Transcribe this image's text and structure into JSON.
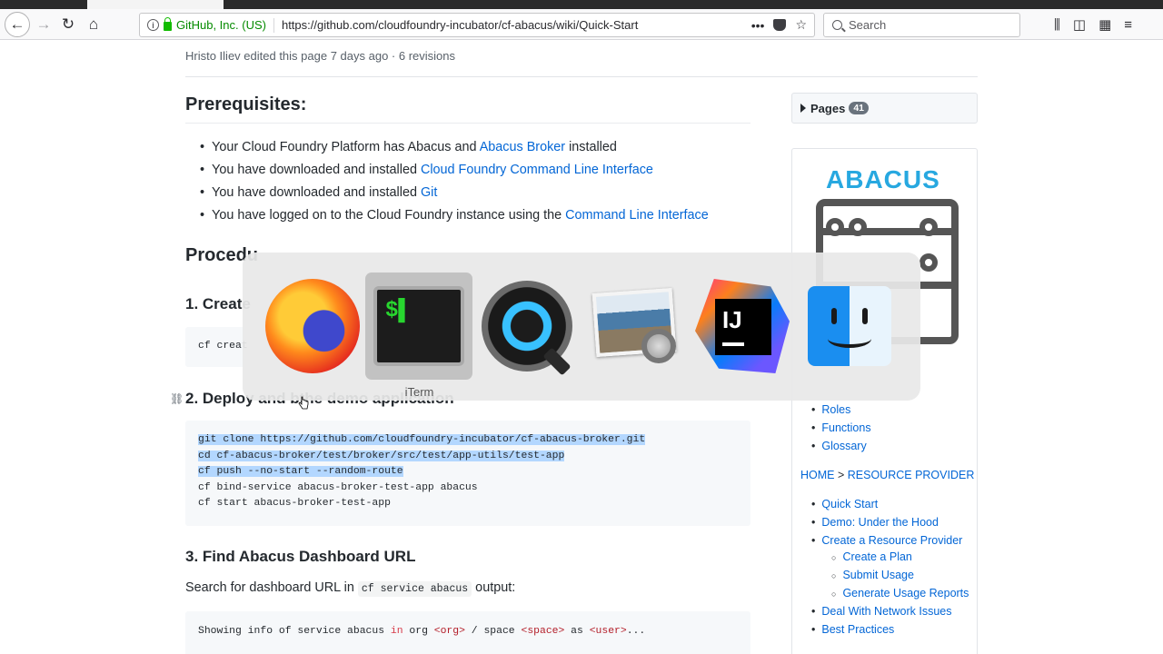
{
  "browser": {
    "org_label": "GitHub, Inc. (US)",
    "url": "https://github.com/cloudfoundry-incubator/cf-abacus/wiki/Quick-Start",
    "more_label": "•••",
    "search_placeholder": "Search",
    "menu_label": "≡"
  },
  "page": {
    "edit_info": "Hristo Iliev edited this page 7 days ago · 6 revisions",
    "prereq_title": "Prerequisites:",
    "prereq_items": [
      {
        "before": "Your Cloud Foundry Platform has Abacus and ",
        "link": "Abacus Broker",
        "after": " installed"
      },
      {
        "before": "You have downloaded and installed ",
        "link": "Cloud Foundry Command Line Interface",
        "after": ""
      },
      {
        "before": "You have downloaded and installed ",
        "link": "Git",
        "after": ""
      },
      {
        "before": "You have logged on to the Cloud Foundry instance using the ",
        "link": "Command Line Interface",
        "after": ""
      }
    ],
    "procedure_title": "Procedu",
    "step1_title": "1. Create",
    "step1_code": "cf creat",
    "step2_title_a": "2. Deploy and b",
    "step2_title_b": "the demo application",
    "step2_code": [
      "git clone https://github.com/cloudfoundry-incubator/cf-abacus-broker.git",
      "cd cf-abacus-broker/test/broker/src/test/app-utils/test-app",
      "cf push --no-start --random-route",
      "cf bind-service abacus-broker-test-app abacus",
      "cf start abacus-broker-test-app"
    ],
    "step3_title": "3. Find Abacus Dashboard URL",
    "step3_para_before": "Search for dashboard URL in ",
    "step3_para_code": "cf service abacus",
    "step3_para_after": " output:",
    "step3_code": {
      "p1": "Showing info of service abacus ",
      "in": "in",
      "p2": " org ",
      "org": "<org>",
      "p3": " / space ",
      "space": "<space>",
      "p4": " as ",
      "user": "<user>",
      "p5": "..."
    }
  },
  "sidebar": {
    "pages_label": "Pages",
    "pages_count": "41",
    "logo_text": "ABACUS",
    "top_items": [
      "Roles",
      "Functions",
      "Glossary"
    ],
    "crumb_home": "HOME",
    "crumb_sep": " > ",
    "crumb_section": "RESOURCE PROVIDER",
    "rp_items_a": [
      "Quick Start",
      "Demo: Under the Hood",
      "Create a Resource Provider"
    ],
    "rp_subitems": [
      "Create a Plan",
      "Submit Usage",
      "Generate Usage Reports"
    ],
    "rp_items_b": [
      "Deal With Network Issues",
      "Best Practices"
    ]
  },
  "switcher": {
    "apps": [
      "firefox-icon",
      "iterm-icon",
      "quicktime-icon",
      "preview-icon",
      "intellij-icon",
      "finder-icon"
    ],
    "selected_label": "iTerm"
  },
  "colors": {
    "link": "#0366d6",
    "selection": "#b3d7ff",
    "abacus_blue": "#27a8e0"
  }
}
